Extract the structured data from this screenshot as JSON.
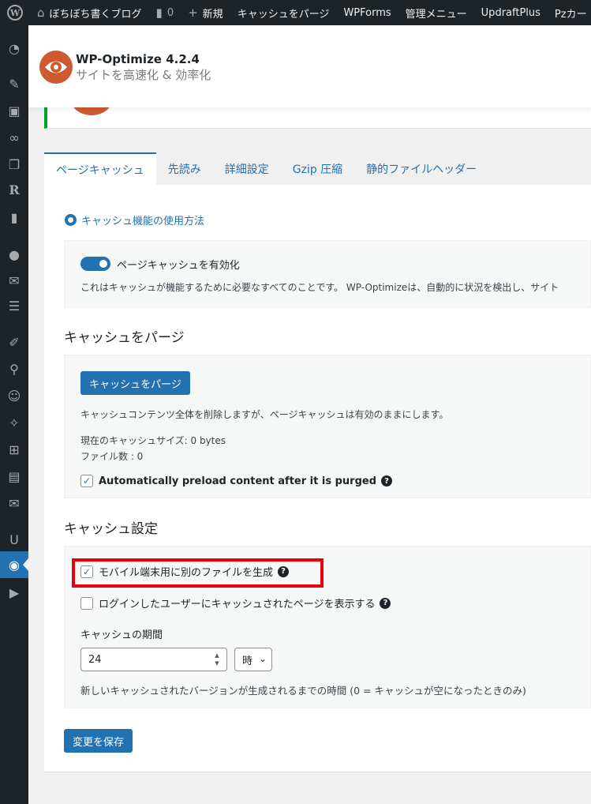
{
  "adminbar": {
    "site_name": "ぼちぼち書くブログ",
    "comments_count": "0",
    "new_label": "新規",
    "purge_cache": "キャッシュをパージ",
    "wpforms": "WPForms",
    "admin_menu": "管理メニュー",
    "updraftplus": "UpdraftPlus",
    "pz": "Pzカー"
  },
  "plugin": {
    "title": "WP-Optimize 4.2.4",
    "subtitle": "サイトを高速化 & 効率化"
  },
  "tabs": [
    {
      "label": "ページキャッシュ",
      "active": true
    },
    {
      "label": "先読み"
    },
    {
      "label": "詳細設定"
    },
    {
      "label": "Gzip 圧縮"
    },
    {
      "label": "静的ファイルヘッダー"
    }
  ],
  "help_link": "キャッシュ機能の使用方法",
  "enable_box": {
    "toggle_label": "ページキャッシュを有効化",
    "toggle_on": true,
    "description": "これはキャッシュが機能するために必要なすべてのことです。 WP-Optimizeは、自動的に状況を検出し、サイト"
  },
  "purge_section": {
    "title": "キャッシュをパージ",
    "button": "キャッシュをパージ",
    "description": "キャッシュコンテンツ全体を削除しますが、ページキャッシュは有効のままにします。",
    "cache_size": "現在のキャッシュサイズ: 0 bytes",
    "file_count": "ファイル数 : 0",
    "preload_label": "Automatically preload content after it is purged",
    "preload_checked": true
  },
  "settings_section": {
    "title": "キャッシュ設定",
    "mobile_label": "モバイル端末用に別のファイルを生成",
    "mobile_checked": true,
    "logged_in_label": "ログインしたユーザーにキャッシュされたページを表示する",
    "logged_in_checked": false,
    "lifespan_label": "キャッシュの期間",
    "lifespan_value": "24",
    "lifespan_unit": "時",
    "lifespan_desc": "新しいキャッシュされたバージョンが生成されるまでの時間 (0 = キャッシュが空になったときのみ)"
  },
  "save_button": "変更を保存",
  "colors": {
    "primary": "#2271b1",
    "admin_bar": "#1d2327",
    "highlight": "#e50012",
    "logo": "#cd5a32"
  }
}
